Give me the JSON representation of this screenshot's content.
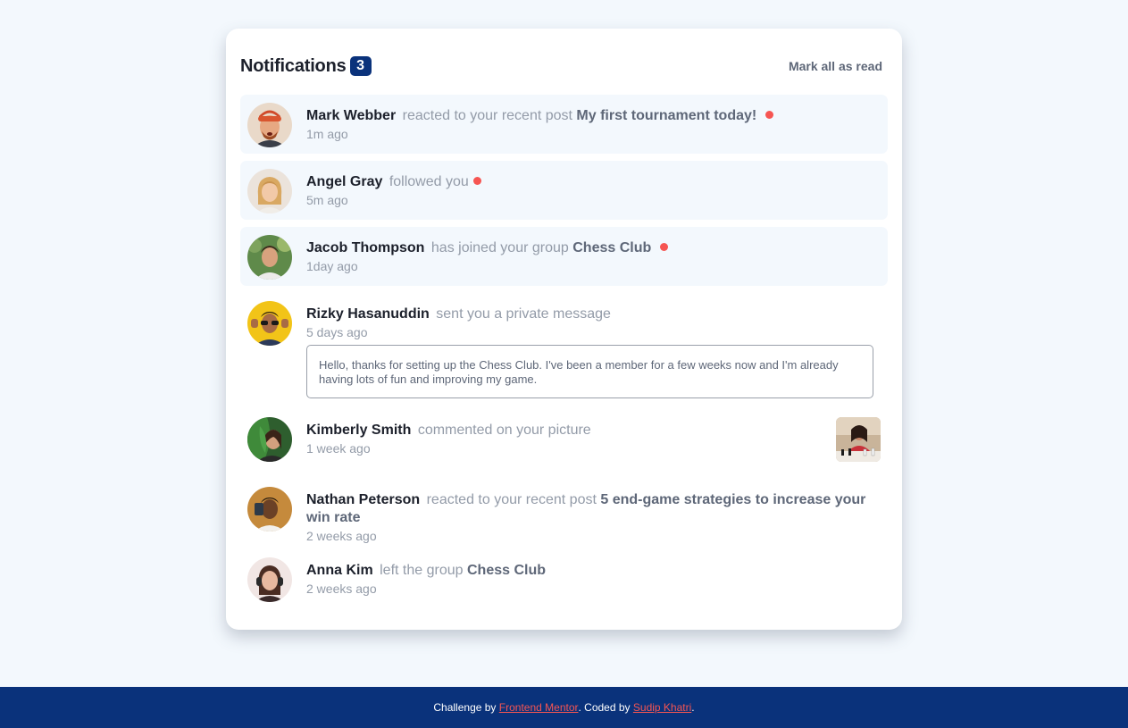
{
  "header": {
    "title": "Notifications",
    "unread_count": "3",
    "mark_all_label": "Mark all as read"
  },
  "notifications": [
    {
      "user": "Mark Webber",
      "action": "reacted to your recent post",
      "object": "My first tournament today!",
      "time": "1m ago",
      "unread": true
    },
    {
      "user": "Angel Gray",
      "action": "followed you",
      "object": "",
      "time": "5m ago",
      "unread": true
    },
    {
      "user": "Jacob Thompson",
      "action": "has joined your group",
      "object": "Chess Club",
      "time": "1day ago",
      "unread": true
    },
    {
      "user": "Rizky Hasanuddin",
      "action": "sent you a private message",
      "object": "",
      "time": "5 days ago",
      "unread": false,
      "message": "Hello, thanks for setting up the Chess Club. I've been a member for a few weeks now and I'm already having lots of fun and improving my game."
    },
    {
      "user": "Kimberly Smith",
      "action": "commented on your picture",
      "object": "",
      "time": "1 week ago",
      "unread": false
    },
    {
      "user": "Nathan Peterson",
      "action": "reacted to your recent post",
      "object": "5 end-game strategies to increase your win rate",
      "time": "2 weeks ago",
      "unread": false
    },
    {
      "user": "Anna Kim",
      "action": "left the group",
      "object": "Chess Club",
      "time": "2 weeks ago",
      "unread": false
    }
  ],
  "footer": {
    "prefix": "Challenge by ",
    "link1": "Frontend Mentor",
    "middle": ". Coded by ",
    "link2": "Sudip Khatri",
    "suffix": "."
  },
  "colors": {
    "background": "#f3f8fd",
    "badge": "#0a327b",
    "unread_dot": "#f65552",
    "footer": "#0a327b"
  }
}
